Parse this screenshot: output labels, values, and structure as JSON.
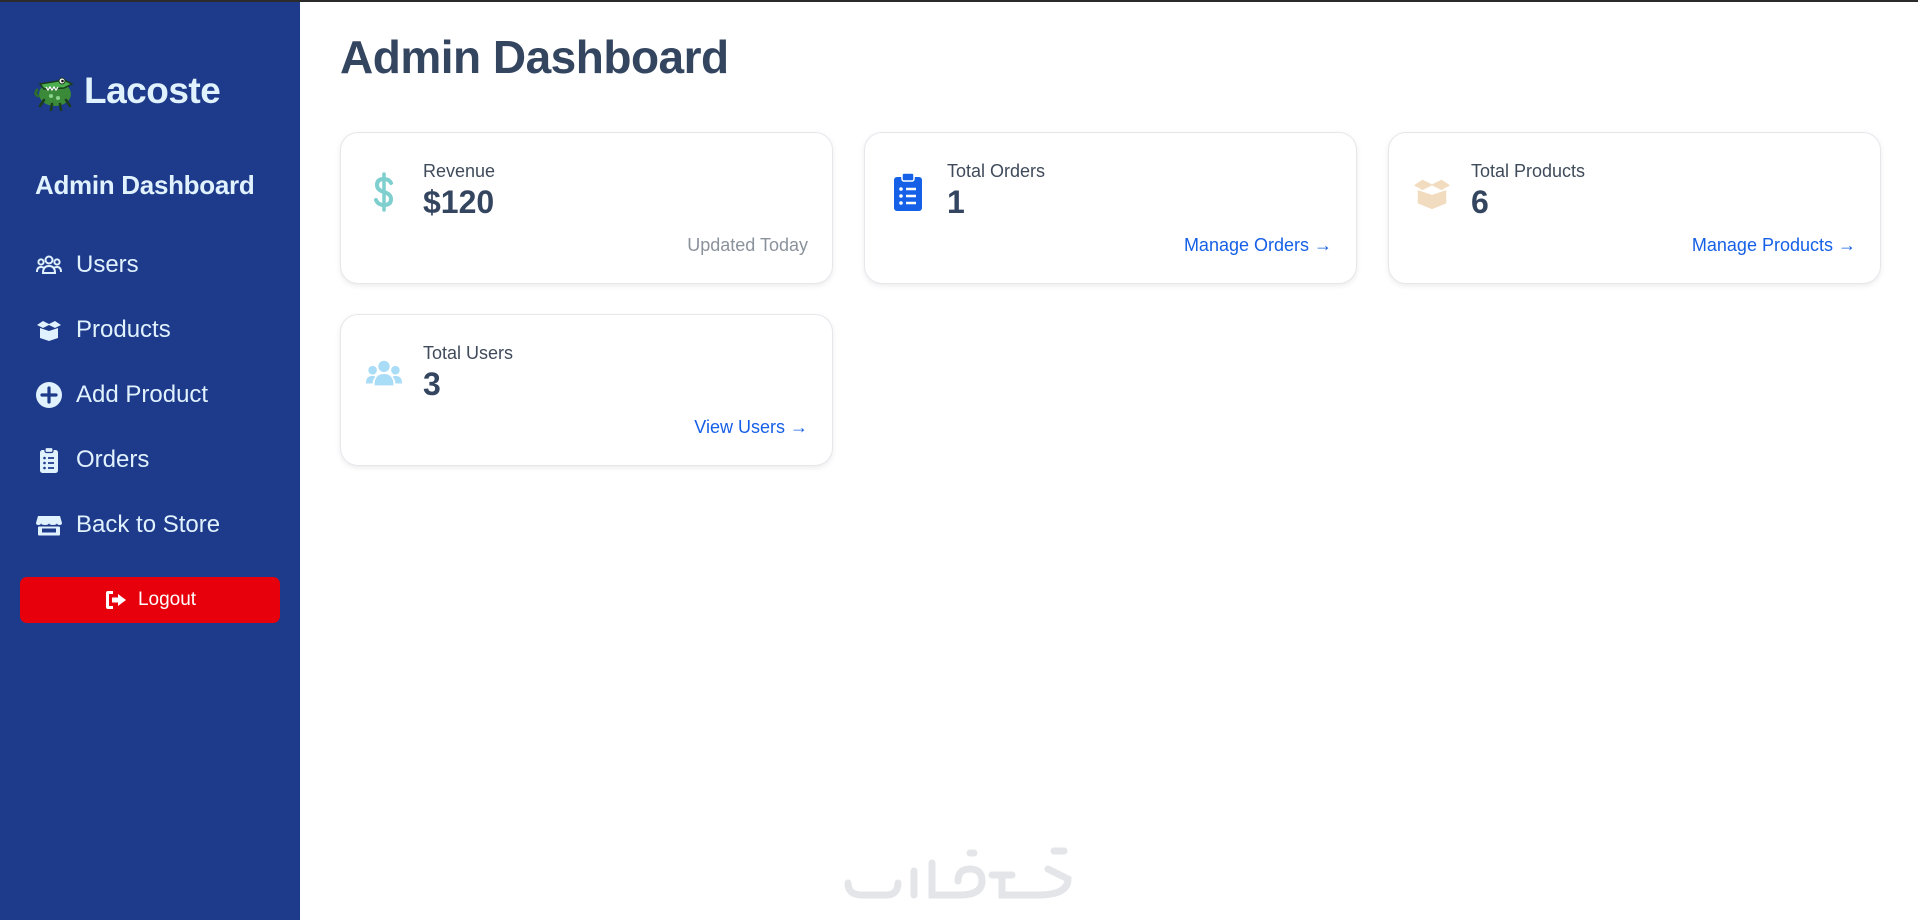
{
  "brand": {
    "name": "Lacoste",
    "logo_icon": "crocodile-logo"
  },
  "sidebar": {
    "heading": "Admin Dashboard",
    "items": [
      {
        "label": "Users",
        "icon": "users-icon"
      },
      {
        "label": "Products",
        "icon": "box-open-icon"
      },
      {
        "label": "Add Product",
        "icon": "plus-circle-icon"
      },
      {
        "label": "Orders",
        "icon": "clipboard-list-icon"
      },
      {
        "label": "Back to Store",
        "icon": "store-icon"
      }
    ],
    "logout_label": "Logout"
  },
  "main": {
    "title": "Admin Dashboard",
    "cards": [
      {
        "label": "Revenue",
        "value": "$120",
        "footer": "Updated Today",
        "icon": "dollar-icon",
        "icon_color": "#7fcfcf"
      },
      {
        "label": "Total Orders",
        "value": "1",
        "footer": "Manage Orders →",
        "icon": "clipboard-list-icon",
        "icon_color": "#1560e6"
      },
      {
        "label": "Total Products",
        "value": "6",
        "footer": "Manage Products →",
        "icon": "box-open-icon",
        "icon_color": "#f2dcc0"
      },
      {
        "label": "Total Users",
        "value": "3",
        "footer": "View Users →",
        "icon": "users-icon",
        "icon_color": "#a9dcf7"
      }
    ]
  },
  "colors": {
    "sidebar_bg": "#1e3a8a",
    "sidebar_text": "#e0f2fe",
    "logout_bg": "#e7000b",
    "link": "#1560e6",
    "title": "#344560"
  }
}
